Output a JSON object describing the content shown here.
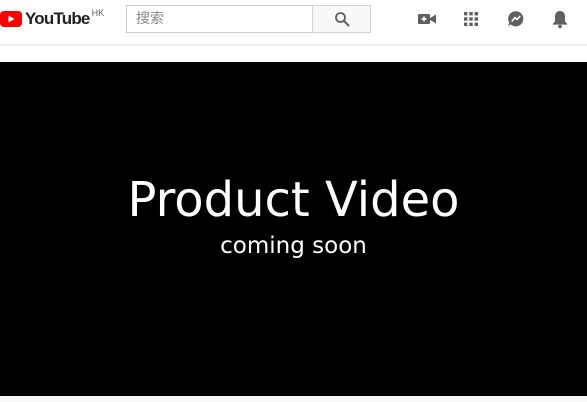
{
  "header": {
    "logo_text": "YouTube",
    "logo_region": "HK",
    "search": {
      "placeholder": "搜索"
    },
    "icons": {
      "search_button": "search-icon",
      "create": "video-camera-icon",
      "apps": "apps-grid-icon",
      "messages": "chat-icon",
      "notifications": "bell-icon"
    }
  },
  "player": {
    "title": "Product Video",
    "subtitle": "coming soon"
  },
  "colors": {
    "brand_red": "#ff0000",
    "icon_gray": "#606060",
    "player_bg": "#000000",
    "player_text": "#ffffff"
  }
}
